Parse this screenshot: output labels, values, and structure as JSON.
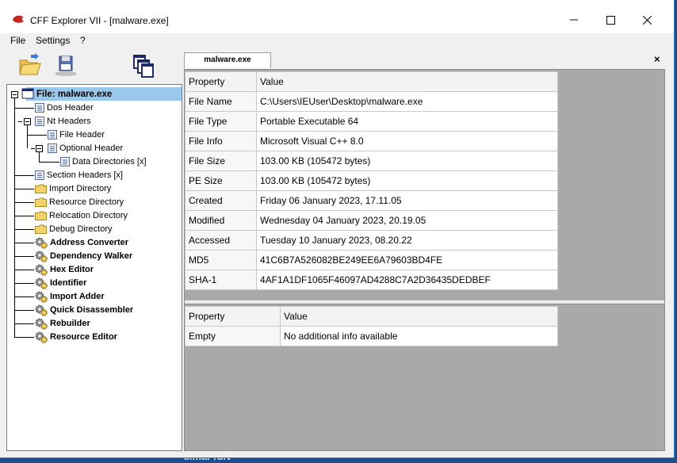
{
  "window": {
    "title": "CFF Explorer VII - [malware.exe]"
  },
  "menu": [
    "File",
    "Settings",
    "?"
  ],
  "tree": {
    "root": "File: malware.exe",
    "items": [
      {
        "label": "Dos Header"
      },
      {
        "label": "Nt Headers"
      },
      {
        "label": "File Header"
      },
      {
        "label": "Optional Header"
      },
      {
        "label": "Data Directories [x]"
      },
      {
        "label": "Section Headers [x]"
      },
      {
        "label": "Import Directory"
      },
      {
        "label": "Resource Directory"
      },
      {
        "label": "Relocation Directory"
      },
      {
        "label": "Debug Directory"
      },
      {
        "label": "Address Converter"
      },
      {
        "label": "Dependency Walker"
      },
      {
        "label": "Hex Editor"
      },
      {
        "label": "Identifier"
      },
      {
        "label": "Import Adder"
      },
      {
        "label": "Quick Disassembler"
      },
      {
        "label": "Rebuilder"
      },
      {
        "label": "Resource Editor"
      }
    ]
  },
  "tab": {
    "label": "malware.exe",
    "close": "×"
  },
  "table1": {
    "headers": [
      "Property",
      "Value"
    ],
    "rows": [
      [
        "File Name",
        "C:\\Users\\IEUser\\Desktop\\malware.exe"
      ],
      [
        "File Type",
        "Portable Executable 64"
      ],
      [
        "File Info",
        "Microsoft Visual C++ 8.0"
      ],
      [
        "File Size",
        "103.00 KB (105472 bytes)"
      ],
      [
        "PE Size",
        "103.00 KB (105472 bytes)"
      ],
      [
        "Created",
        "Friday 06 January 2023, 17.11.05"
      ],
      [
        "Modified",
        "Wednesday 04 January 2023, 20.19.05"
      ],
      [
        "Accessed",
        "Tuesday 10 January 2023, 08.20.22"
      ],
      [
        "MD5",
        "41C6B7A526082BE249EE6A79603BD4FE"
      ],
      [
        "SHA-1",
        "4AF1A1DF1065F46097AD4288C7A2D36435DEDBEF"
      ]
    ]
  },
  "table2": {
    "headers": [
      "Property",
      "Value"
    ],
    "rows": [
      [
        "Empty",
        "No additional info available"
      ]
    ]
  },
  "desktop": {
    "partial_text": "slmar /dlv"
  }
}
